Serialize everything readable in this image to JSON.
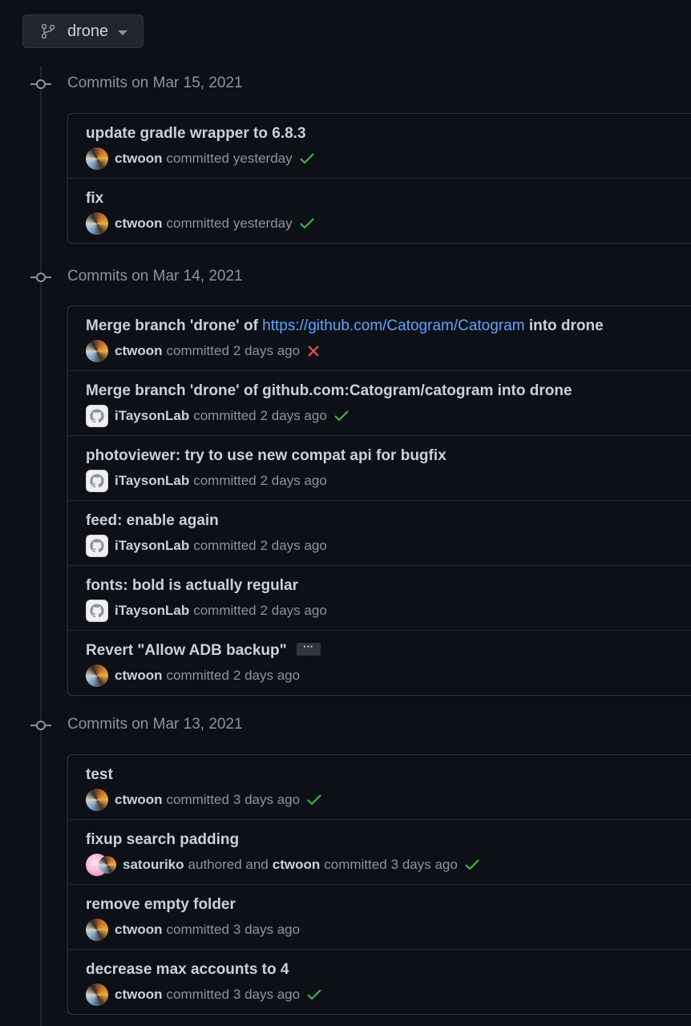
{
  "branch": {
    "name": "drone",
    "icon": "git-branch-icon"
  },
  "colors": {
    "background": "#0d1117",
    "link": "#58a6ff",
    "success": "#3fb950",
    "failure": "#f85149"
  },
  "groups": [
    {
      "header": "Commits on Mar 15, 2021",
      "commits": [
        {
          "message": "update gradle wrapper to 6.8.3",
          "author": "ctwoon",
          "verb": "committed",
          "time": "yesterday",
          "status": "success"
        },
        {
          "message": "fix",
          "author": "ctwoon",
          "verb": "committed",
          "time": "yesterday",
          "status": "success"
        }
      ]
    },
    {
      "header": "Commits on Mar 14, 2021",
      "commits": [
        {
          "message_prefix": "Merge branch 'drone' of ",
          "message_link": "https://github.com/Catogram/Catogram",
          "message_suffix": " into drone",
          "author": "ctwoon",
          "verb": "committed",
          "time": "2 days ago",
          "status": "failure"
        },
        {
          "message": "Merge branch 'drone' of github.com:Catogram/catogram into drone",
          "author": "iTaysonLab",
          "verb": "committed",
          "time": "2 days ago",
          "status": "success"
        },
        {
          "message": "photoviewer: try to use new compat api for bugfix",
          "author": "iTaysonLab",
          "verb": "committed",
          "time": "2 days ago",
          "status": "none"
        },
        {
          "message": "feed: enable again",
          "author": "iTaysonLab",
          "verb": "committed",
          "time": "2 days ago",
          "status": "none"
        },
        {
          "message": "fonts: bold is actually regular",
          "author": "iTaysonLab",
          "verb": "committed",
          "time": "2 days ago",
          "status": "none"
        },
        {
          "message": "Revert \"Allow ADB backup\"",
          "ellipsis": "···",
          "author": "ctwoon",
          "verb": "committed",
          "time": "2 days ago",
          "status": "none"
        }
      ]
    },
    {
      "header": "Commits on Mar 13, 2021",
      "commits": [
        {
          "message": "test",
          "author": "ctwoon",
          "verb": "committed",
          "time": "3 days ago",
          "status": "success"
        },
        {
          "message": "fixup search padding",
          "author": "satouriko",
          "verb": "authored and",
          "committer": "ctwoon",
          "verb2": "committed",
          "time": "3 days ago",
          "status": "success"
        },
        {
          "message": "remove empty folder",
          "author": "ctwoon",
          "verb": "committed",
          "time": "3 days ago",
          "status": "none"
        },
        {
          "message": "decrease max accounts to 4",
          "author": "ctwoon",
          "verb": "committed",
          "time": "3 days ago",
          "status": "success"
        }
      ]
    }
  ]
}
